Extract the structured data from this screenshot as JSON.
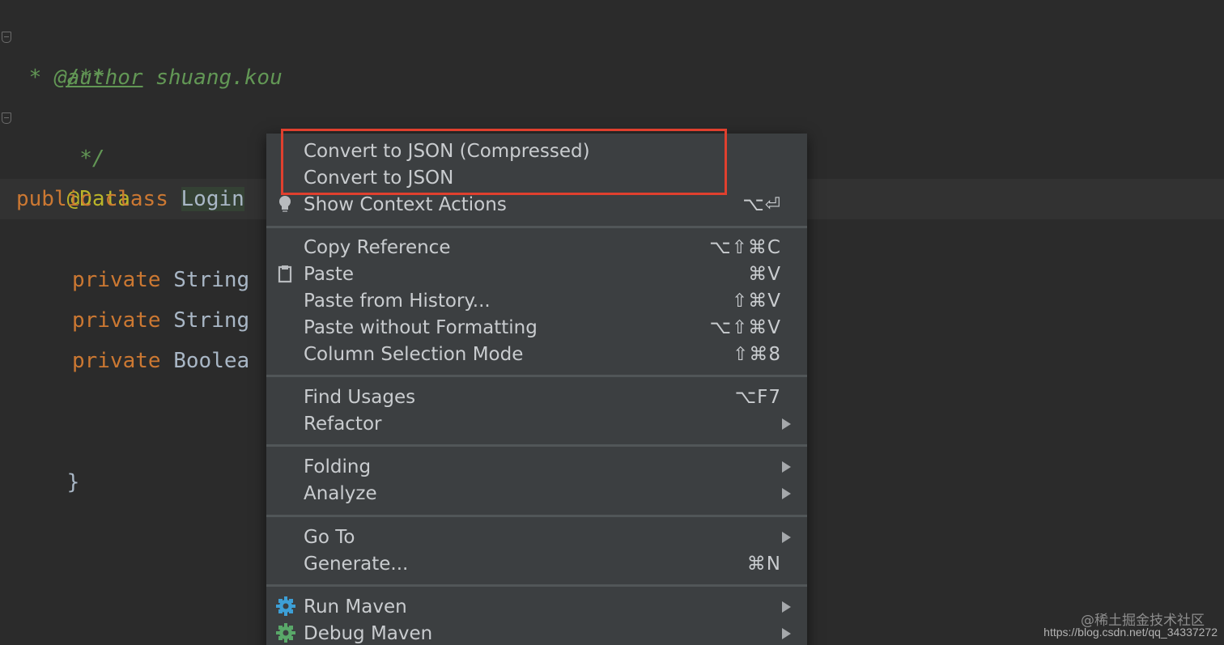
{
  "editor": {
    "doc_open": "/**",
    "doc_author_prefix": " * ",
    "doc_author_tag": "@author",
    "doc_author_name": " shuang.kou",
    "doc_close": " */",
    "annotation": "@Data",
    "class_kw1": "public",
    "class_kw2": "class",
    "class_name": "Login",
    "fields": [
      {
        "kw": "private",
        "type": "String"
      },
      {
        "kw": "private",
        "type": "String"
      },
      {
        "kw": "private",
        "type": "Boolea"
      }
    ],
    "closing_brace": "}"
  },
  "context_menu": {
    "items": [
      {
        "label": "Convert to JSON (Compressed)",
        "shortcut": ""
      },
      {
        "label": "Convert to JSON",
        "shortcut": ""
      },
      {
        "label": "Show Context Actions",
        "shortcut": "⌥⏎",
        "icon": "lightbulb-icon"
      },
      {
        "label": "Copy Reference",
        "shortcut": "⌥⇧⌘C"
      },
      {
        "label": "Paste",
        "shortcut": "⌘V",
        "icon": "clipboard-icon"
      },
      {
        "label": "Paste from History...",
        "shortcut": "⇧⌘V"
      },
      {
        "label": "Paste without Formatting",
        "shortcut": "⌥⇧⌘V"
      },
      {
        "label": "Column Selection Mode",
        "shortcut": "⇧⌘8"
      },
      {
        "label": "Find Usages",
        "shortcut": "⌥F7"
      },
      {
        "label": "Refactor",
        "submenu": true
      },
      {
        "label": "Folding",
        "submenu": true
      },
      {
        "label": "Analyze",
        "submenu": true
      },
      {
        "label": "Go To",
        "submenu": true
      },
      {
        "label": "Generate...",
        "shortcut": "⌘N"
      },
      {
        "label": "Run Maven",
        "submenu": true,
        "icon": "gear-icon"
      },
      {
        "label": "Debug Maven",
        "submenu": true,
        "icon": "debug-gear-icon"
      }
    ]
  },
  "watermark": {
    "line1": "@稀土掘金技术社区",
    "line2": "https://blog.csdn.net/qq_34337272"
  },
  "colors": {
    "editor_bg": "#2b2b2b",
    "menu_bg": "#3c3f41",
    "highlight_box": "#e0402e",
    "keyword": "#cc7832",
    "doc_comment": "#629755",
    "annotation": "#bbb529"
  }
}
